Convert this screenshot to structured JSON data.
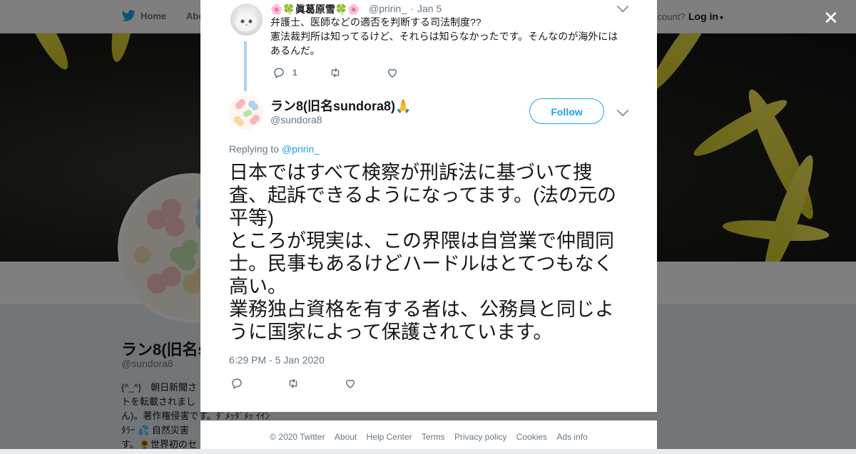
{
  "nav": {
    "home": "Home",
    "about": "Abo",
    "account_text": "ccount?",
    "login": "Log in"
  },
  "profile": {
    "name": "ラン8(旧名s",
    "handle": "@sundora8",
    "bio": [
      "{^_^}　朝日新聞さ",
      "トを転載されまし",
      "ん)。著作権侵害です。ﾀﾞﾒｯﾀﾞﾒｯ ｲｲﾝ",
      "ﾀﾗｰ 💦 自然災害",
      "す。🌻世界初のセ"
    ]
  },
  "parent_tweet": {
    "name": "🌸🍀眞葛原雪🍀🌸",
    "handle": "@pririn_",
    "date": "Jan 5",
    "text": "弁護士、医師などの適否を判断する司法制度??\n憲法裁判所は知ってるけど、それらは知らなかったです。そんなのが海外にはあるんだ。",
    "reply_count": "1"
  },
  "main_tweet": {
    "name": "ラン8(旧名sundora8)🙏",
    "handle": "@sundora8",
    "follow_label": "Follow",
    "replying_label": "Replying to",
    "replying_handle": "@pririn_",
    "text": "日本ではすべて検察が刑訴法に基づいて捜査、起訴できるようになってます。(法の元の平等)\nところが現実は、この界隈は自営業で仲間同士。民事もあるけどハードルはとてつもなく高い。\n業務独占資格を有する者は、公務員と同じように国家によって保護されています。",
    "timestamp": "6:29 PM - 5 Jan 2020"
  },
  "footer": {
    "links": [
      "© 2020 Twitter",
      "About",
      "Help Center",
      "Terms",
      "Privacy policy",
      "Cookies",
      "Ads info"
    ]
  },
  "colors": {
    "accent": "#1da1f2",
    "text": "#14171a",
    "muted": "#657786",
    "thread": "#a8d5f5"
  },
  "icons": [
    "twitter-bird-icon",
    "close-icon",
    "chevron-down-icon",
    "reply-icon",
    "retweet-icon",
    "like-icon"
  ]
}
